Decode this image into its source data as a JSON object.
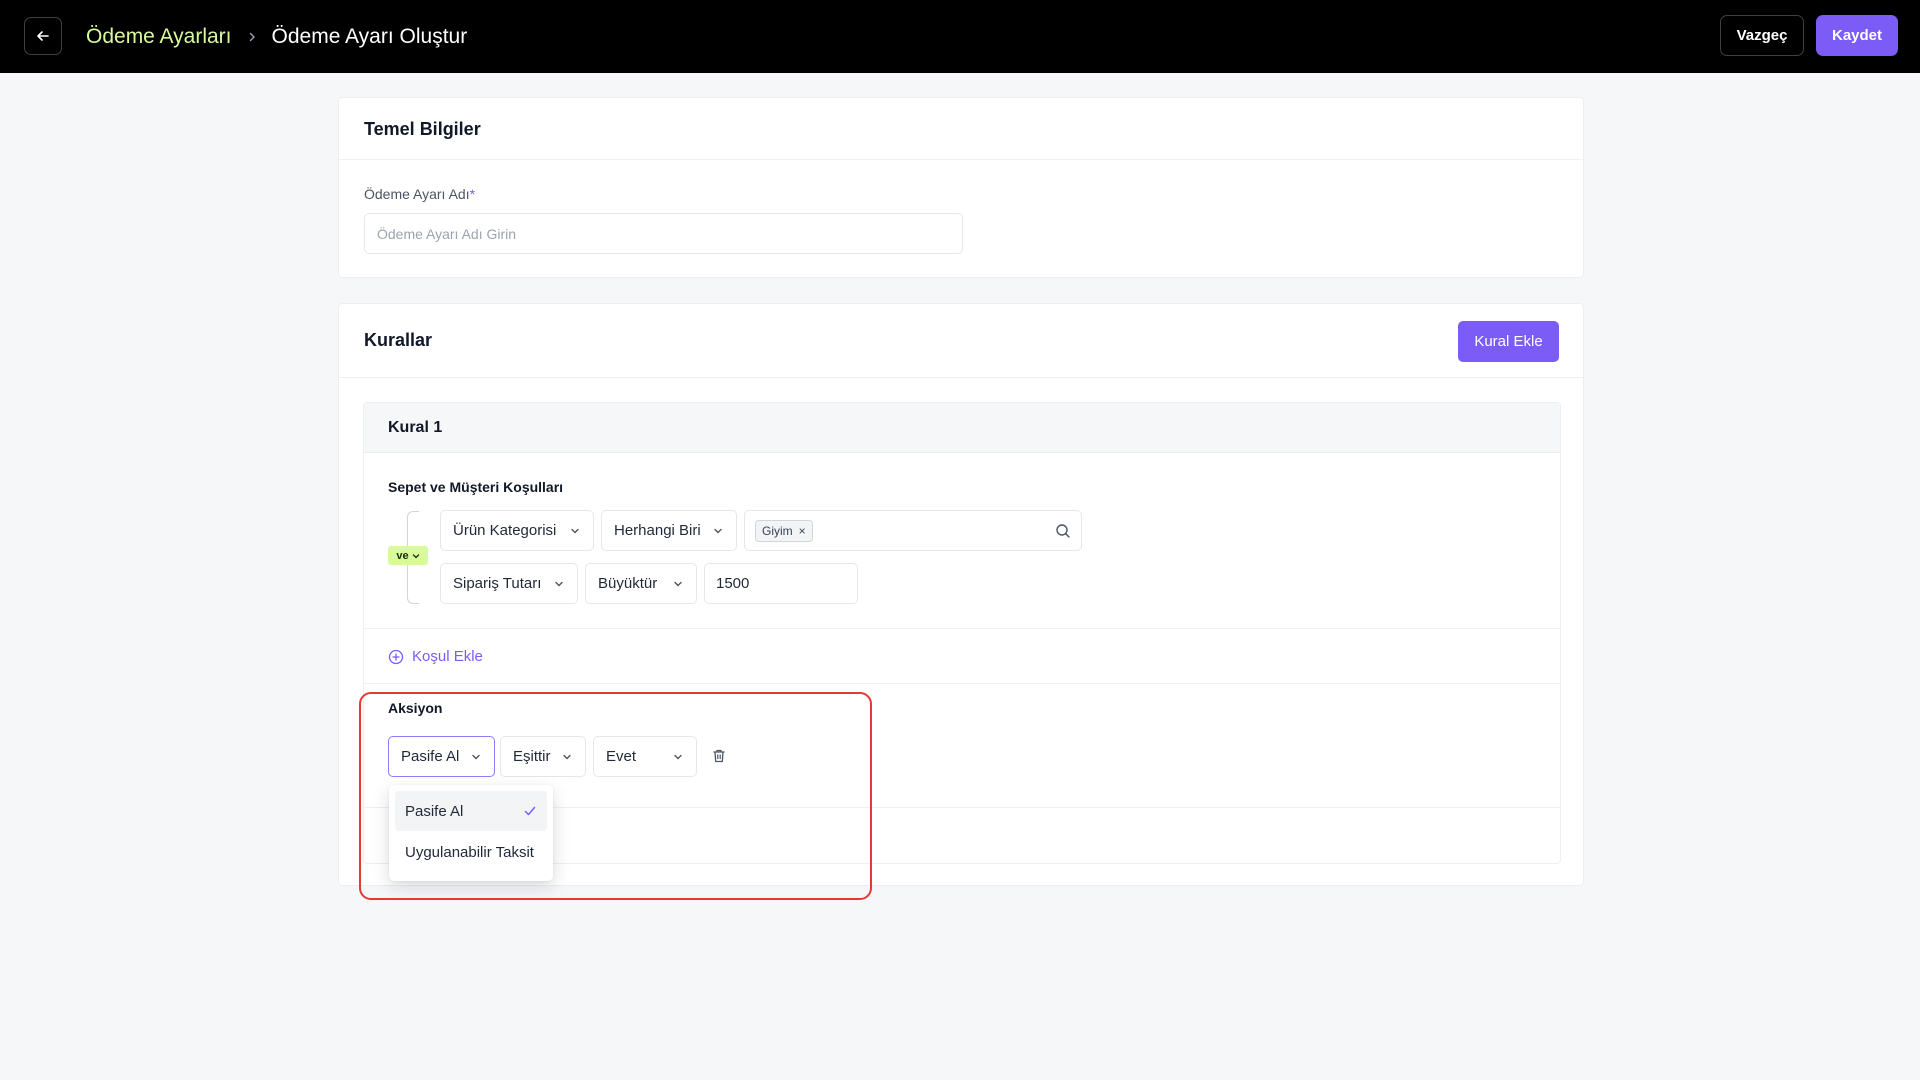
{
  "header": {
    "breadcrumb_parent": "Ödeme Ayarları",
    "breadcrumb_current": "Ödeme Ayarı Oluştur",
    "cancel_label": "Vazgeç",
    "save_label": "Kaydet"
  },
  "basic": {
    "title": "Temel Bilgiler",
    "name_label": "Ödeme Ayarı Adı",
    "required_mark": "*",
    "name_placeholder": "Ödeme Ayarı Adı Girin",
    "name_value": ""
  },
  "rules": {
    "title": "Kurallar",
    "add_rule_label": "Kural Ekle",
    "rule": {
      "title": "Kural 1",
      "conditions_label": "Sepet ve Müşteri Koşulları",
      "logic_operator": "ve",
      "conditions": [
        {
          "field": "Ürün Kategorisi",
          "operator": "Herhangi Biri",
          "tags": [
            "Giyim"
          ]
        },
        {
          "field": "Sipariş Tutarı",
          "operator": "Büyüktür",
          "value": "1500"
        }
      ],
      "add_condition_label": "Koşul Ekle",
      "action_label": "Aksiyon",
      "action": {
        "type": "Pasife Al",
        "operator": "Eşittir",
        "value": "Evet"
      }
    }
  },
  "dropdown": {
    "options": [
      "Pasife Al",
      "Uygulanabilir Taksit"
    ],
    "selected": "Pasife Al"
  },
  "colors": {
    "accent": "#7c5cf6",
    "breadcrumb_link": "#d9f99d",
    "badge_bg": "#d9f99d",
    "highlight": "#e53935"
  },
  "icons": [
    "arrow-left-icon",
    "chevron-right-icon",
    "chevron-down-icon",
    "close-icon",
    "search-icon",
    "plus-circle-icon",
    "trash-icon",
    "check-icon"
  ]
}
